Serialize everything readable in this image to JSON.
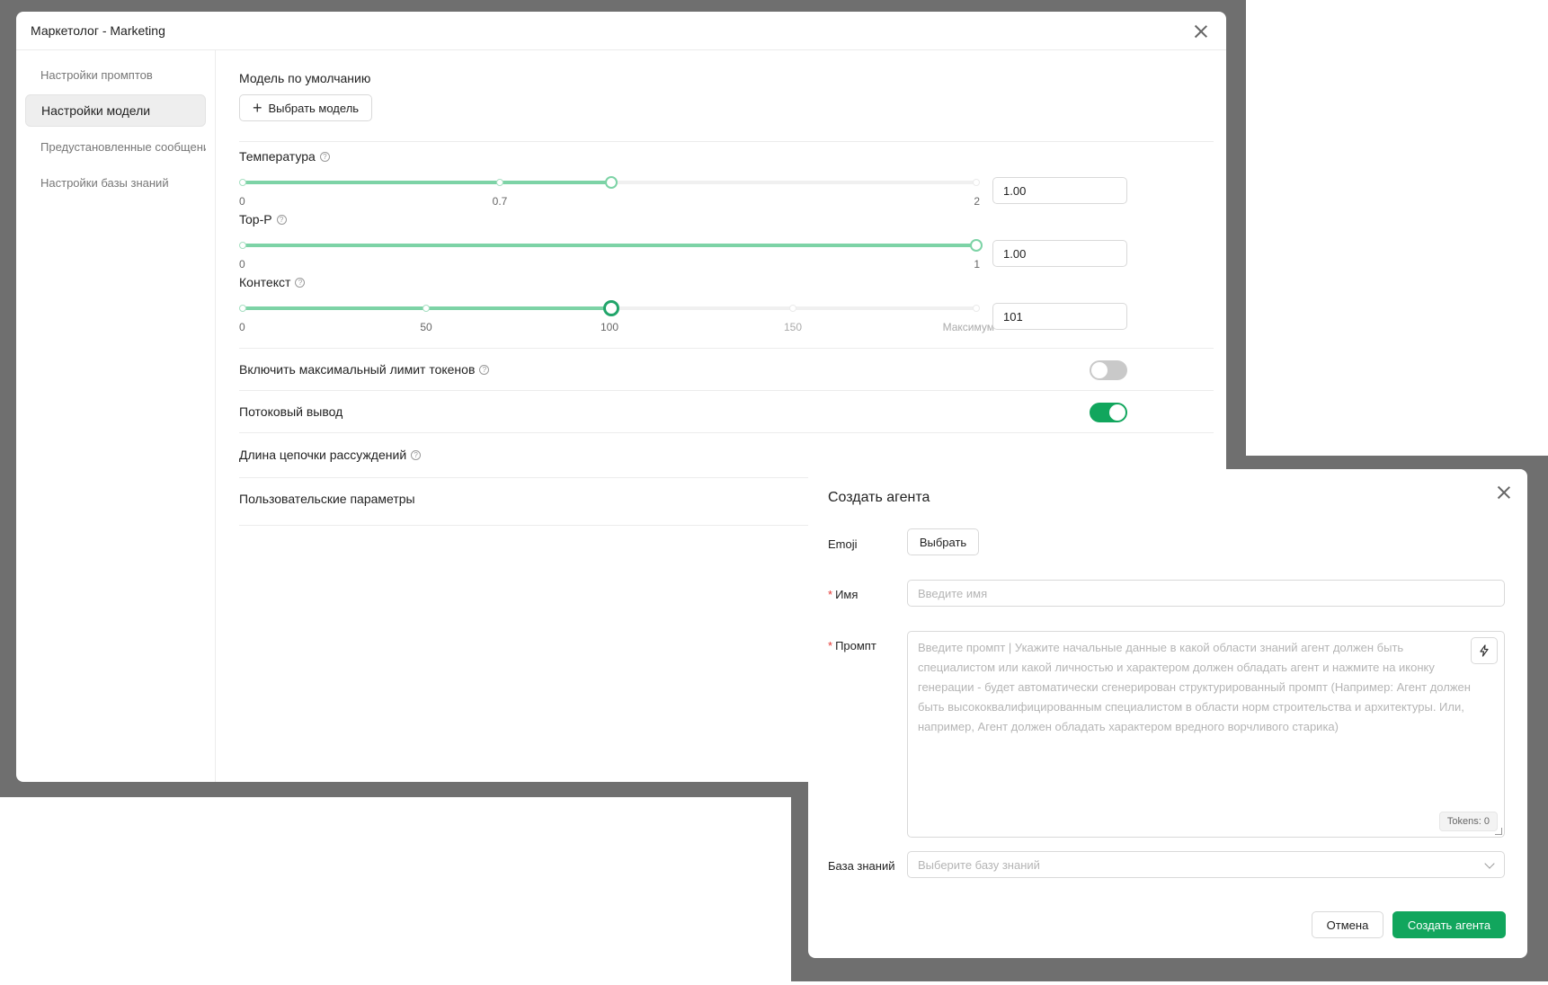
{
  "settings_modal": {
    "title": "Маркетолог - Marketing",
    "sidebar": {
      "items": [
        {
          "label": "Настройки промптов"
        },
        {
          "label": "Настройки модели"
        },
        {
          "label": "Предустановленные сообщения"
        },
        {
          "label": "Настройки базы знаний"
        }
      ]
    },
    "default_model": {
      "label": "Модель по умолчанию",
      "button_label": "Выбрать модель"
    },
    "temperature": {
      "label": "Температура",
      "value": "1.00",
      "level": 1.0,
      "marks": [
        "0",
        "0.7",
        "2"
      ]
    },
    "top_p": {
      "label": "Top-P",
      "value": "1.00",
      "level": 1.0,
      "marks": [
        "0",
        "1"
      ]
    },
    "context": {
      "label": "Контекст",
      "value": "101",
      "level": 100,
      "marks": [
        "0",
        "50",
        "100",
        "150",
        "Максимум"
      ]
    },
    "max_tokens": {
      "label": "Включить максимальный лимит токенов",
      "enabled": false
    },
    "stream": {
      "label": "Потоковый вывод",
      "enabled": true
    },
    "reasoning": {
      "label": "Длина цепочки рассуждений"
    },
    "custom_params": {
      "label": "Пользовательские параметры"
    }
  },
  "agent_dialog": {
    "title": "Создать агента",
    "emoji": {
      "label": "Emoji",
      "button_label": "Выбрать"
    },
    "name": {
      "label": "Имя",
      "placeholder": "Введите имя"
    },
    "prompt": {
      "label": "Промпт",
      "placeholder": "Введите промпт | Укажите начальные данные в какой области знаний агент должен быть специалистом или какой личностью и характером должен обладать агент и нажмите на иконку генерации - будет автоматически сгенерирован структурированный промпт (Например: Агент должен быть высококвалифицированным специалистом в области норм строительства и архитектуры. Или, например, Агент должен обладать характером вредного ворчливого старика)",
      "tokens": "Tokens: 0"
    },
    "knowledge": {
      "label": "База знаний",
      "placeholder": "Выберите базу знаний"
    },
    "cancel_label": "Отмена",
    "create_label": "Создать агента"
  }
}
